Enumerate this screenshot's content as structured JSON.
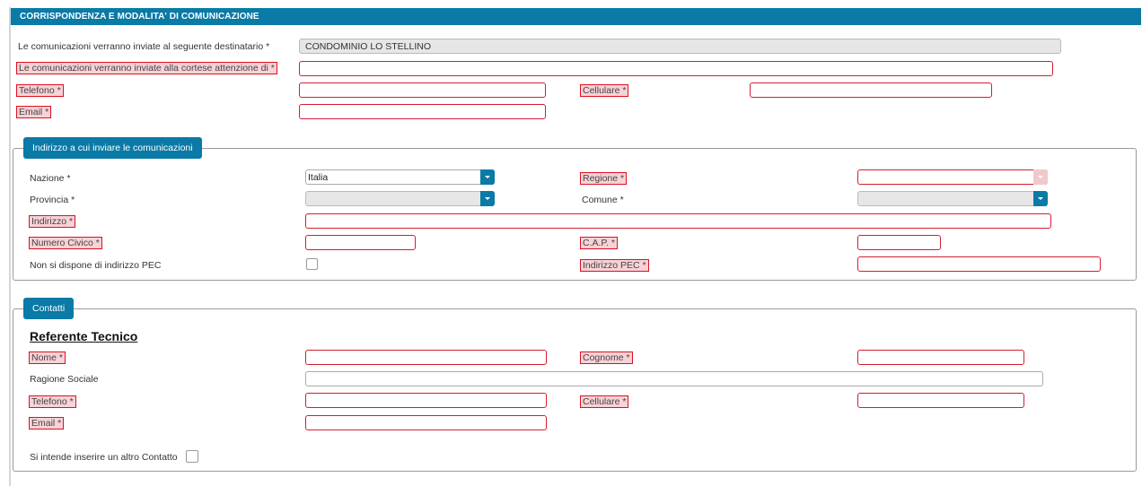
{
  "header": {
    "title": "CORRISPONDENZA E MODALITA' DI COMUNICAZIONE"
  },
  "top": {
    "destinatario_label": "Le comunicazioni verranno inviate al seguente destinatario *",
    "destinatario_value": "CONDOMINIO LO STELLINO",
    "attenzione_label": "Le comunicazioni verranno inviate alla cortese attenzione di *",
    "telefono_label": "Telefono *",
    "cellulare_label": "Cellulare *",
    "email_label": "Email *"
  },
  "indirizzo": {
    "legend": "Indirizzo a cui inviare le comunicazioni",
    "nazione_label": "Nazione *",
    "nazione_value": "Italia",
    "regione_label": "Regione *",
    "provincia_label": "Provincia *",
    "comune_label": "Comune *",
    "indirizzo_label": "Indirizzo *",
    "numero_civico_label": "Numero Civico *",
    "cap_label": "C.A.P. *",
    "no_pec_label": "Non si dispone di indirizzo PEC",
    "pec_label": "Indirizzo PEC *"
  },
  "contatti": {
    "legend": "Contatti",
    "section_title": "Referente Tecnico",
    "nome_label": "Nome *",
    "cognome_label": "Cognome *",
    "ragione_sociale_label": "Ragione Sociale",
    "telefono_label": "Telefono *",
    "cellulare_label": "Cellulare *",
    "email_label": "Email *",
    "altro_contatto_label": "Si intende inserire un altro Contatto"
  },
  "colors": {
    "accent": "#0a7aa6",
    "error": "#d21f2f",
    "error_bg": "#f7d2d6"
  }
}
